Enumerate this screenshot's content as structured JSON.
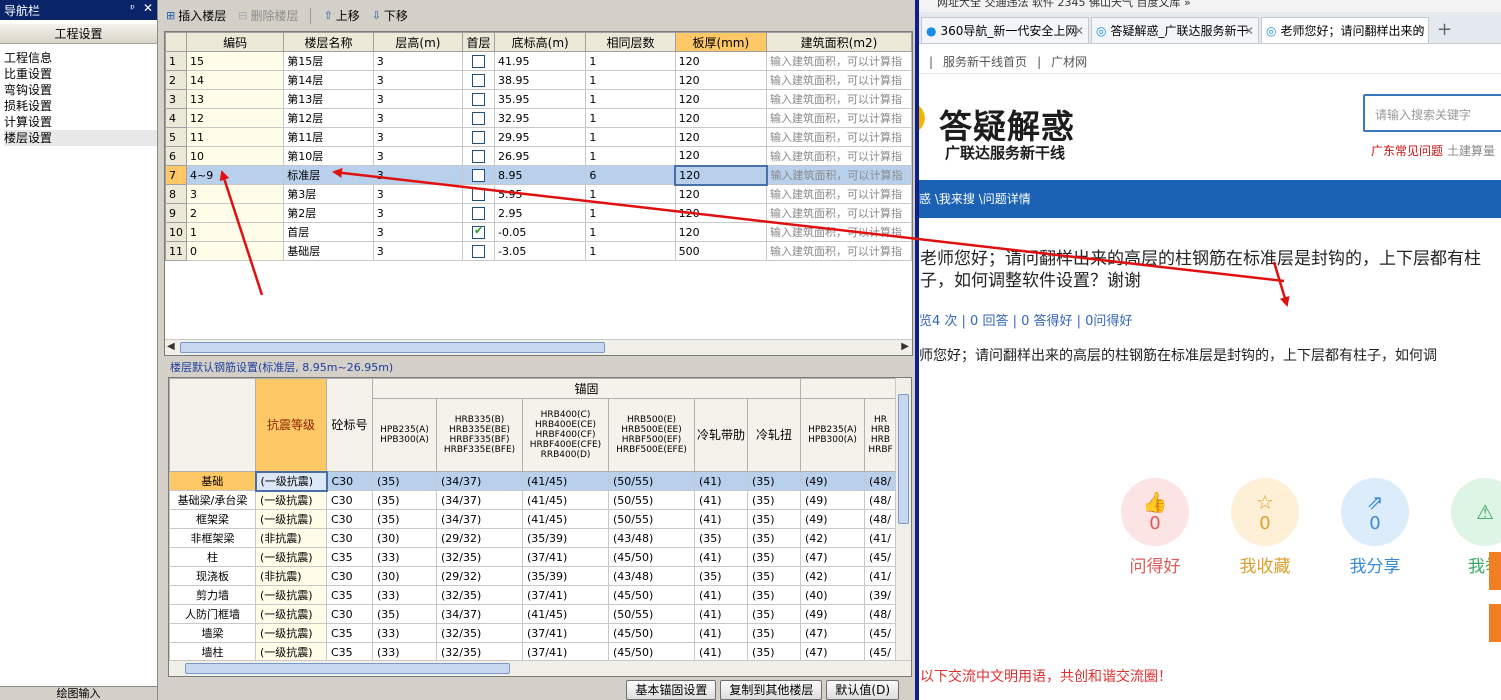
{
  "nav": {
    "title": "导航栏",
    "pin": "ᵖ",
    "close": "✕",
    "section": "工程设置",
    "items": [
      "工程信息",
      "比重设置",
      "弯钩设置",
      "损耗设置",
      "计算设置",
      "楼层设置"
    ],
    "bottom": "绘图输入"
  },
  "toolbar": {
    "insert": "插入楼层",
    "delete": "删除楼层",
    "up": "上移",
    "down": "下移"
  },
  "floors": {
    "headers": [
      "",
      "编码",
      "楼层名称",
      "层高(m)",
      "首层",
      "底标高(m)",
      "相同层数",
      "板厚(mm)",
      "建筑面积(m2)"
    ],
    "rows": [
      {
        "n": "1",
        "code": "15",
        "name": "第15层",
        "h": "3",
        "first": false,
        "elev": "41.95",
        "same": "1",
        "slab": "120",
        "area": "输入建筑面积，可以计算指"
      },
      {
        "n": "2",
        "code": "14",
        "name": "第14层",
        "h": "3",
        "first": false,
        "elev": "38.95",
        "same": "1",
        "slab": "120",
        "area": "输入建筑面积，可以计算指"
      },
      {
        "n": "3",
        "code": "13",
        "name": "第13层",
        "h": "3",
        "first": false,
        "elev": "35.95",
        "same": "1",
        "slab": "120",
        "area": "输入建筑面积，可以计算指"
      },
      {
        "n": "4",
        "code": "12",
        "name": "第12层",
        "h": "3",
        "first": false,
        "elev": "32.95",
        "same": "1",
        "slab": "120",
        "area": "输入建筑面积，可以计算指"
      },
      {
        "n": "5",
        "code": "11",
        "name": "第11层",
        "h": "3",
        "first": false,
        "elev": "29.95",
        "same": "1",
        "slab": "120",
        "area": "输入建筑面积，可以计算指"
      },
      {
        "n": "6",
        "code": "10",
        "name": "第10层",
        "h": "3",
        "first": false,
        "elev": "26.95",
        "same": "1",
        "slab": "120",
        "area": "输入建筑面积，可以计算指"
      },
      {
        "n": "7",
        "code": "4~9",
        "name": "标准层",
        "h": "3",
        "first": false,
        "elev": "8.95",
        "same": "6",
        "slab": "120",
        "area": "输入建筑面积，可以计算指"
      },
      {
        "n": "8",
        "code": "3",
        "name": "第3层",
        "h": "3",
        "first": false,
        "elev": "5.95",
        "same": "1",
        "slab": "120",
        "area": "输入建筑面积，可以计算指"
      },
      {
        "n": "9",
        "code": "2",
        "name": "第2层",
        "h": "3",
        "first": false,
        "elev": "2.95",
        "same": "1",
        "slab": "120",
        "area": "输入建筑面积，可以计算指"
      },
      {
        "n": "10",
        "code": "1",
        "name": "首层",
        "h": "3",
        "first": true,
        "elev": "-0.05",
        "same": "1",
        "slab": "120",
        "area": "输入建筑面积，可以计算指"
      },
      {
        "n": "11",
        "code": "0",
        "name": "基础层",
        "h": "3",
        "first": false,
        "elev": "-3.05",
        "same": "1",
        "slab": "500",
        "area": "输入建筑面积，可以计算指"
      }
    ]
  },
  "rebar": {
    "section_title": "楼层默认钢筋设置(标准层, 8.95m~26.95m)",
    "group_header": "锚固",
    "col_seismic": "抗震等级",
    "col_concrete": "砼标号",
    "col_steel": [
      "HPB235(A)\nHPB300(A)",
      "HRB335(B)\nHRB335E(BE)\nHRBF335(BF)\nHRBF335E(BFE)",
      "HRB400(C)\nHRB400E(CE)\nHRBF400(CF)\nHRBF400E(CFE)\nRRB400(D)",
      "HRB500(E)\nHRB500E(EE)\nHRBF500(EF)\nHRBF500E(EFE)",
      "冷轧带肋",
      "冷轧扭",
      "HPB235(A)\nHPB300(A)",
      "HR\nHRB\nHRB\nHRBF"
    ],
    "rows": [
      {
        "name": "基础",
        "lvl": "(一级抗震)",
        "c": "C30",
        "v": [
          "(35)",
          "(34/37)",
          "(41/45)",
          "(50/55)",
          "(41)",
          "(35)",
          "(49)",
          "(48/"
        ]
      },
      {
        "name": "基础梁/承台梁",
        "lvl": "(一级抗震)",
        "c": "C30",
        "v": [
          "(35)",
          "(34/37)",
          "(41/45)",
          "(50/55)",
          "(41)",
          "(35)",
          "(49)",
          "(48/"
        ]
      },
      {
        "name": "框架梁",
        "lvl": "(一级抗震)",
        "c": "C30",
        "v": [
          "(35)",
          "(34/37)",
          "(41/45)",
          "(50/55)",
          "(41)",
          "(35)",
          "(49)",
          "(48/"
        ]
      },
      {
        "name": "非框架梁",
        "lvl": "(非抗震)",
        "c": "C30",
        "v": [
          "(30)",
          "(29/32)",
          "(35/39)",
          "(43/48)",
          "(35)",
          "(35)",
          "(42)",
          "(41/"
        ]
      },
      {
        "name": "柱",
        "lvl": "(一级抗震)",
        "c": "C35",
        "v": [
          "(33)",
          "(32/35)",
          "(37/41)",
          "(45/50)",
          "(41)",
          "(35)",
          "(47)",
          "(45/"
        ]
      },
      {
        "name": "现浇板",
        "lvl": "(非抗震)",
        "c": "C30",
        "v": [
          "(30)",
          "(29/32)",
          "(35/39)",
          "(43/48)",
          "(35)",
          "(35)",
          "(42)",
          "(41/"
        ]
      },
      {
        "name": "剪力墙",
        "lvl": "(一级抗震)",
        "c": "C35",
        "v": [
          "(33)",
          "(32/35)",
          "(37/41)",
          "(45/50)",
          "(41)",
          "(35)",
          "(40)",
          "(39/"
        ]
      },
      {
        "name": "人防门框墙",
        "lvl": "(一级抗震)",
        "c": "C30",
        "v": [
          "(35)",
          "(34/37)",
          "(41/45)",
          "(50/55)",
          "(41)",
          "(35)",
          "(49)",
          "(48/"
        ]
      },
      {
        "name": "墙梁",
        "lvl": "(一级抗震)",
        "c": "C35",
        "v": [
          "(33)",
          "(32/35)",
          "(37/41)",
          "(45/50)",
          "(41)",
          "(35)",
          "(47)",
          "(45/"
        ]
      },
      {
        "name": "墙柱",
        "lvl": "(一级抗震)",
        "c": "C35",
        "v": [
          "(33)",
          "(32/35)",
          "(37/41)",
          "(45/50)",
          "(41)",
          "(35)",
          "(47)",
          "(45/"
        ]
      }
    ],
    "buttons": [
      "基本锚固设置",
      "复制到其他楼层",
      "默认值(D)"
    ]
  },
  "browser": {
    "bookmarks": "网址大全   交通违法   软件 2345   佛山天气   百度文库 »",
    "tabs": [
      {
        "label": "360导航_新一代安全上网",
        "active": false
      },
      {
        "label": "答疑解惑_广联达服务新干",
        "active": false
      },
      {
        "label": "老师您好；请问翻样出来的",
        "active": true
      }
    ],
    "plus": "+",
    "sitenav": [
      "服务新干线首页",
      "广材网"
    ],
    "logo_main": "答疑解惑",
    "logo_sub": "广联达服务新干线",
    "search_placeholder": "请输入搜索关键字",
    "quick_links": [
      "广东常见问题",
      "土建算量"
    ],
    "breadcrumb": "惑 \\我来搜 \\问题详情",
    "question_title": "老师您好；请问翻样出来的高层的柱钢筋在标准层是封钩的，上下层都有柱子，如何调整软件设置？谢谢",
    "stats": "览4 次 | 0 回答 | 0 答得好 | 0问得好",
    "question_body": "师您好；请问翻样出来的高层的柱钢筋在标准层是封钩的，上下层都有柱子，如何调",
    "actions": [
      {
        "icon": "thumbs-up",
        "glyph": "👍",
        "count": "0",
        "label": "问得好"
      },
      {
        "icon": "star",
        "glyph": "☆",
        "count": "0",
        "label": "我收藏"
      },
      {
        "icon": "share",
        "glyph": "⇗",
        "count": "0",
        "label": "我分享"
      },
      {
        "icon": "warning",
        "glyph": "⚠",
        "count": "",
        "label": "我举"
      }
    ],
    "footer_note": "以下交流中文明用语，共创和谐交流圈！"
  },
  "colors": {
    "highlight": "#ffc867",
    "selection": "#b8d0ec",
    "brand_blue": "#1b62b4",
    "arrow_red": "#e01010"
  }
}
